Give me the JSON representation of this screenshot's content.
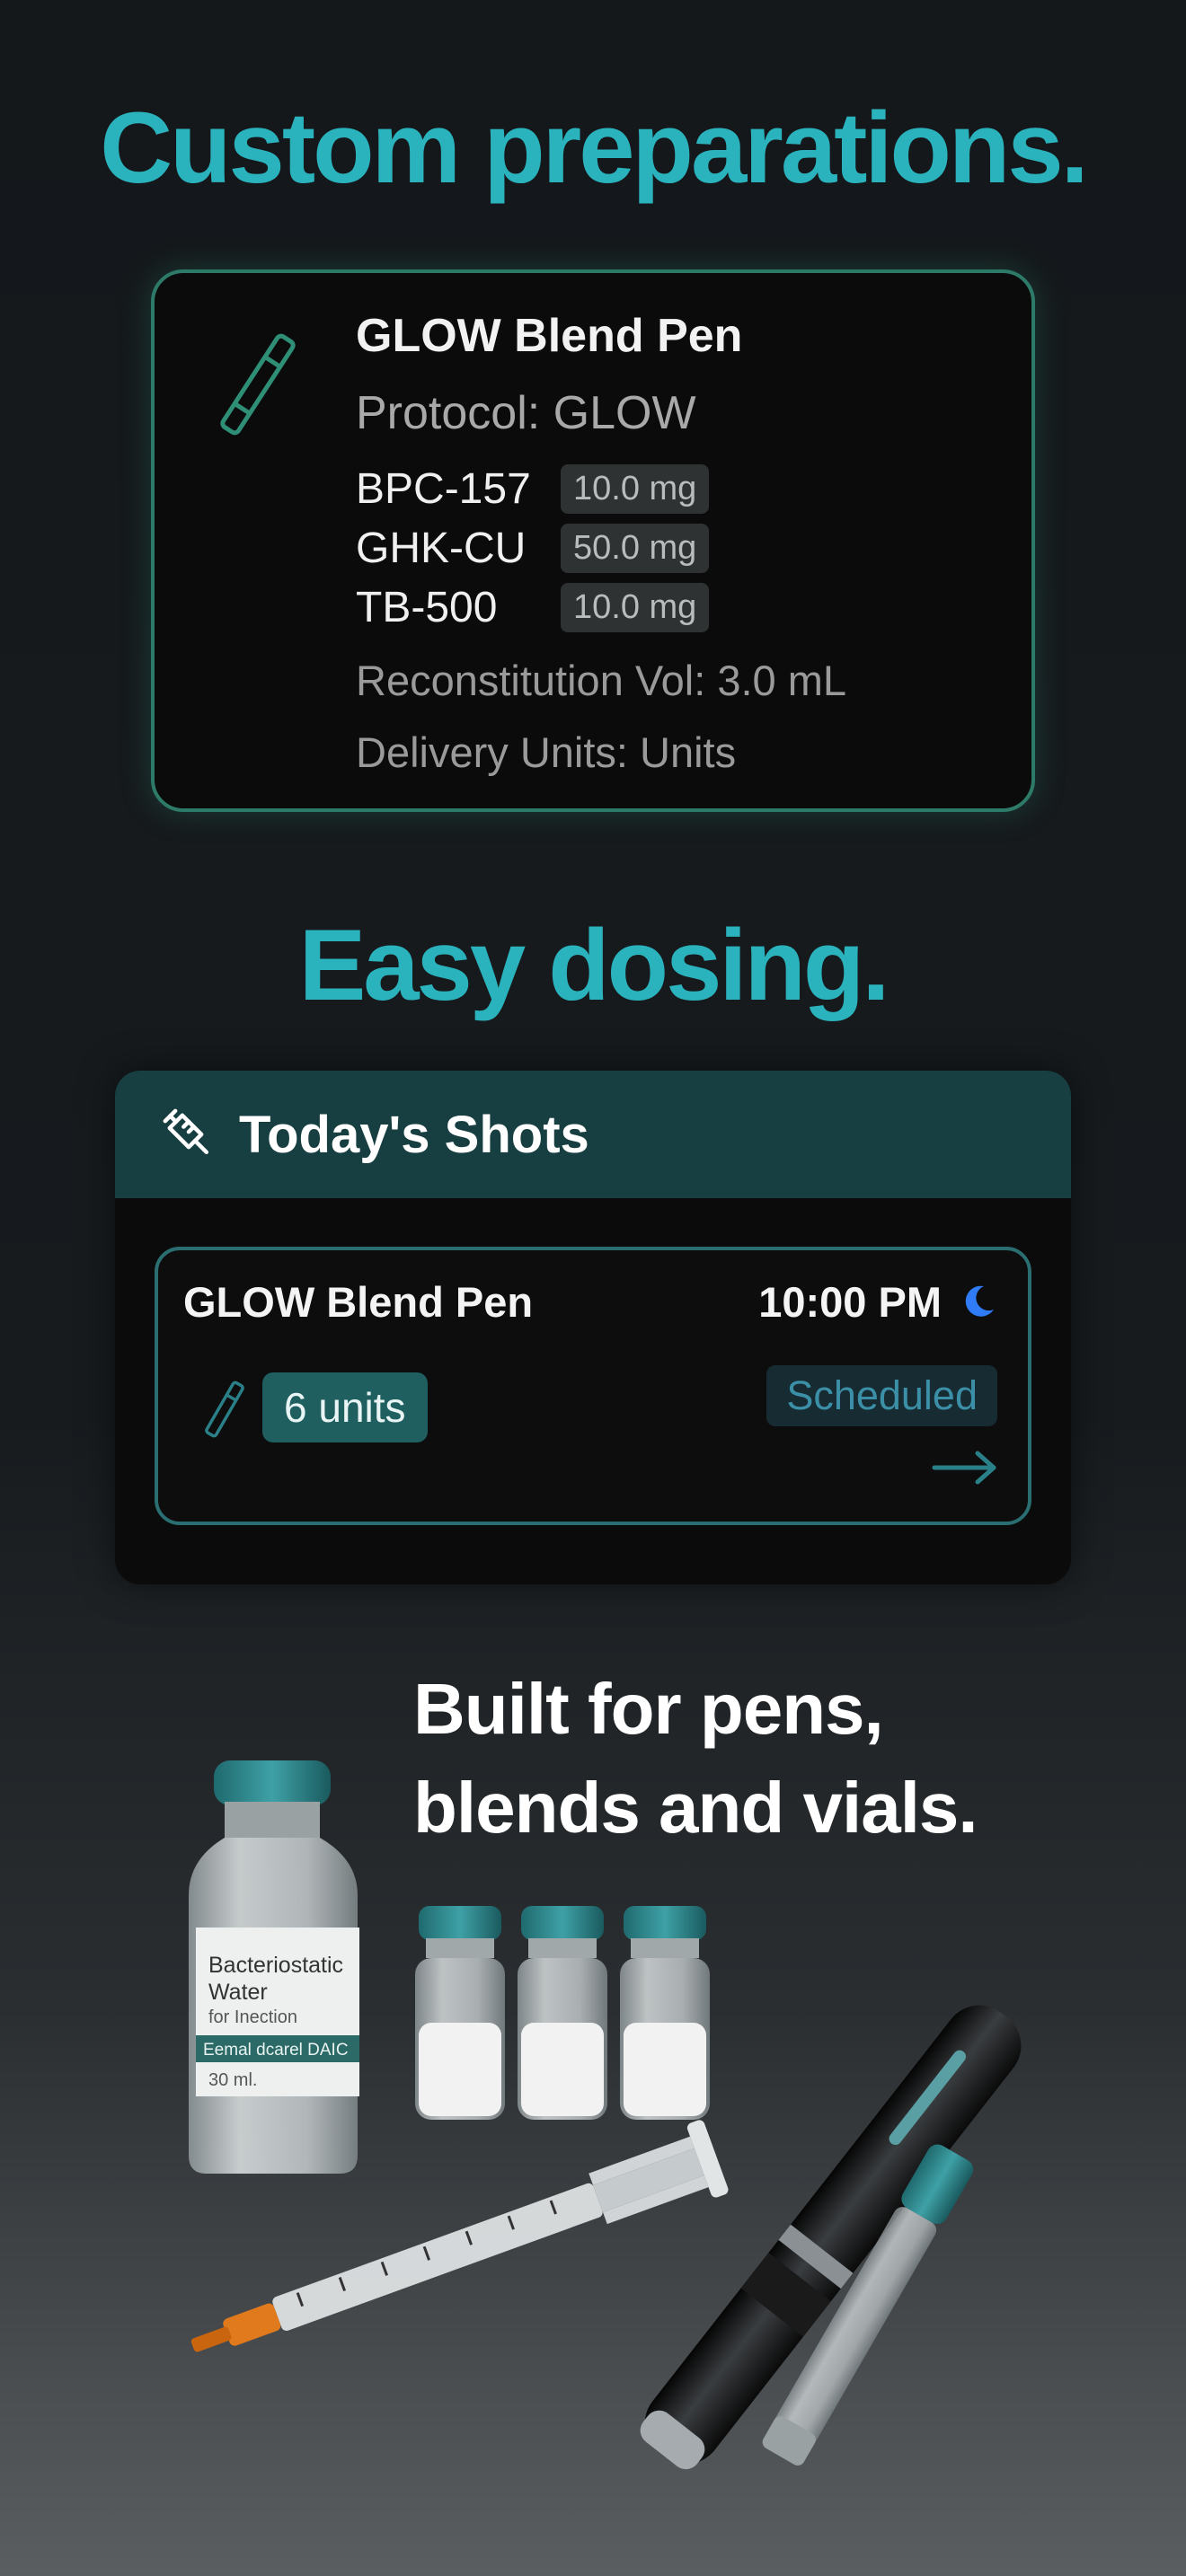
{
  "headlines": {
    "custom": "Custom preparations.",
    "easy": "Easy dosing.",
    "built_line1": "Built for pens,",
    "built_line2": "blends and vials."
  },
  "preparation": {
    "title": "GLOW Blend Pen",
    "protocol": "Protocol: GLOW",
    "ingredients": [
      {
        "name": "BPC-157",
        "amount": "10.0 mg"
      },
      {
        "name": "GHK-CU",
        "amount": "50.0 mg"
      },
      {
        "name": "TB-500",
        "amount": "10.0 mg"
      }
    ],
    "reconstitution": "Reconstitution Vol: 3.0 mL",
    "delivery": "Delivery Units: Units",
    "icon": "pen-icon"
  },
  "todays_shots": {
    "header": "Today's Shots",
    "header_icon": "syringe-icon",
    "shot": {
      "name": "GLOW Blend Pen",
      "time": "10:00 PM",
      "time_icon": "moon-icon",
      "dose": "6 units",
      "status": "Scheduled",
      "action_icon": "arrow-right-icon"
    }
  },
  "illustration": {
    "vial_label_line1": "Bacteriostatic",
    "vial_label_line2": "Water",
    "vial_label_line3": "for Inection",
    "vial_label_band": "Eemal dcarel DAIC",
    "vial_label_volume": "30 ml."
  },
  "colors": {
    "accent": "#2bb3bd",
    "card_border": "#2e7a69",
    "header_bg": "#173e40",
    "moon": "#2f7cf6"
  }
}
